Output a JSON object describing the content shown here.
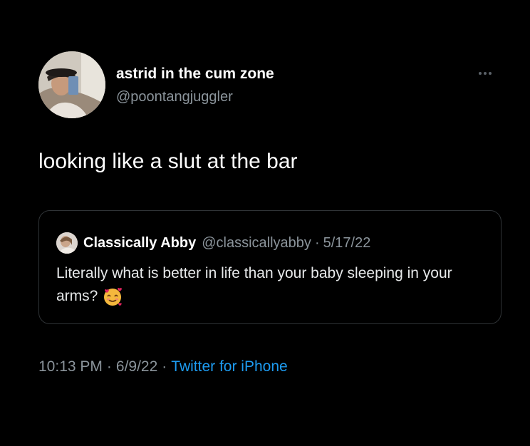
{
  "tweet": {
    "author": {
      "display_name": "astrid in the cum zone",
      "handle": "@poontangjuggler"
    },
    "text": "looking like a slut at the bar",
    "more_icon": "more-horizontal-icon",
    "quoted": {
      "author_name": "Classically Abby",
      "author_handle": "@classicallyabby",
      "separator": "·",
      "date": "5/17/22",
      "text": "Literally what is better in life than your baby sleeping in your arms?",
      "emoji_icon": "smiling-face-with-hearts-icon"
    },
    "meta": {
      "time": "10:13 PM",
      "separator": "·",
      "date": "6/9/22",
      "source": "Twitter for iPhone"
    }
  },
  "colors": {
    "background": "#000000",
    "primary_text": "#ffffff",
    "secondary_text": "#8b949b",
    "link": "#1d9bf0",
    "border": "#2f3336"
  }
}
